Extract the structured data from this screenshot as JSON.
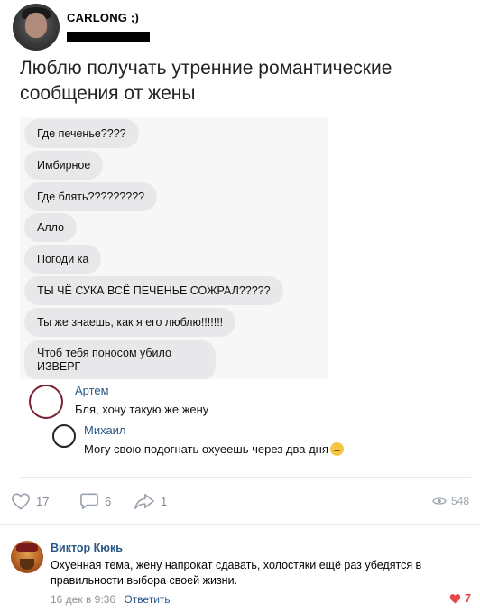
{
  "post": {
    "author": "CARLONG ;)",
    "text": "Люблю получать утренние романтические сообщения от жены"
  },
  "chat_messages": [
    "Где печенье????",
    "Имбирное",
    "Где блять?????????",
    "Алло",
    "Погоди ка",
    "ТЫ ЧЁ СУКА ВСЁ ПЕЧЕНЬЕ СОЖРАЛ?????",
    "Ты же знаешь, как я его люблю!!!!!!!",
    "Чтоб тебя поносом убило ИЗВЕРГ"
  ],
  "replies": [
    {
      "name": "Артем",
      "text": "Бля, хочу такую же жену"
    },
    {
      "name": "Михаил",
      "text": "Могу свою подогнать охуеешь через два дня"
    }
  ],
  "actions": {
    "likes": "17",
    "comments": "6",
    "shares": "1",
    "views": "548"
  },
  "icons": {
    "like": "heart-outline-icon",
    "comment": "speech-bubble-icon",
    "share": "share-arrow-icon",
    "views": "eye-icon",
    "comment_like": "heart-filled-icon",
    "reply_emoji": "smirk-emoji-icon"
  },
  "colors": {
    "link": "#2a5885",
    "muted": "#828a99",
    "like_active": "#e64646",
    "bubble": "#e8e8ea"
  },
  "comment": {
    "author": "Виктор Кюкь",
    "text": "Охуенная тема, жену напрокат сдавать, холостяки ещё раз убедятся в правильности выбора своей жизни.",
    "date": "16 дек в 9:36",
    "reply_label": "Ответить",
    "likes": "7"
  }
}
